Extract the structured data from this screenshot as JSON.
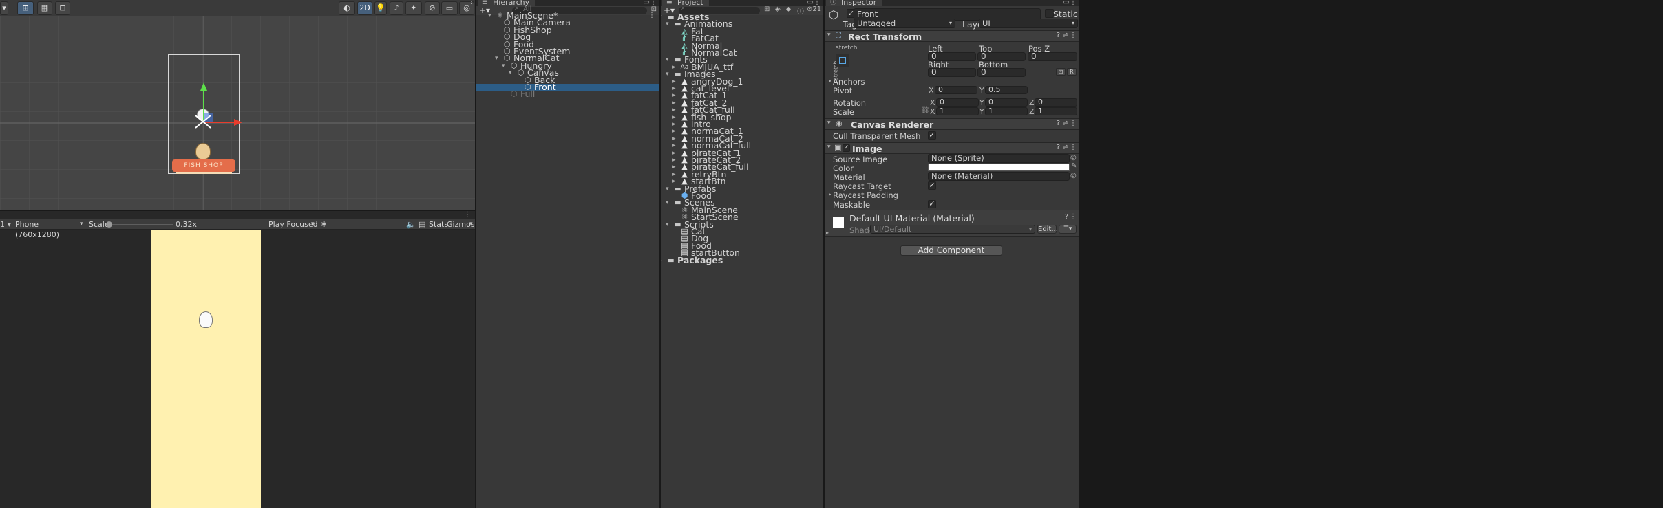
{
  "scene": {
    "toolbar_2d": "2D",
    "canvas_label": "FISH SHOP"
  },
  "game": {
    "display_value": "1",
    "resolution": "Phone (760x1280)",
    "scale_label": "Scale",
    "scale_value": "0.32x",
    "scale_level": 0.02,
    "play_mode": "Play Focused",
    "stats_label": "Stats",
    "gizmos_label": "Gizmos"
  },
  "hierarchy": {
    "tab": "Hierarchy",
    "search_placeholder": "All",
    "items": [
      {
        "label": "MainScene*",
        "depth": 0,
        "type": "scene",
        "expanded": true
      },
      {
        "label": "Main Camera",
        "depth": 1,
        "type": "object"
      },
      {
        "label": "FishShop",
        "depth": 1,
        "type": "object"
      },
      {
        "label": "Dog",
        "depth": 1,
        "type": "object"
      },
      {
        "label": "Food",
        "depth": 1,
        "type": "object"
      },
      {
        "label": "EventSystem",
        "depth": 1,
        "type": "object"
      },
      {
        "label": "NormalCat",
        "depth": 1,
        "type": "object",
        "expanded": true
      },
      {
        "label": "Hungry",
        "depth": 2,
        "type": "object",
        "expanded": true
      },
      {
        "label": "Canvas",
        "depth": 3,
        "type": "object",
        "expanded": true
      },
      {
        "label": "Back",
        "depth": 4,
        "type": "object"
      },
      {
        "label": "Front",
        "depth": 4,
        "type": "object",
        "selected": true
      },
      {
        "label": "Full",
        "depth": 2,
        "type": "object",
        "inactive": true
      }
    ]
  },
  "project": {
    "tab": "Project",
    "hidden_count": "21",
    "items": [
      {
        "label": "Assets",
        "depth": 0,
        "type": "folder",
        "expanded": true,
        "bold": true
      },
      {
        "label": "Animations",
        "depth": 1,
        "type": "folder",
        "expanded": true
      },
      {
        "label": "Fat",
        "depth": 2,
        "type": "anim"
      },
      {
        "label": "FatCat",
        "depth": 2,
        "type": "controller"
      },
      {
        "label": "Normal",
        "depth": 2,
        "type": "anim"
      },
      {
        "label": "NormalCat",
        "depth": 2,
        "type": "controller"
      },
      {
        "label": "Fonts",
        "depth": 1,
        "type": "folder",
        "expanded": true
      },
      {
        "label": "BMJUA_ttf",
        "depth": 2,
        "type": "font",
        "collapsed": true
      },
      {
        "label": "Images",
        "depth": 1,
        "type": "folder",
        "expanded": true
      },
      {
        "label": "angryDog_1",
        "depth": 2,
        "type": "sprite",
        "collapsed": true
      },
      {
        "label": "cat_level",
        "depth": 2,
        "type": "sprite",
        "collapsed": true
      },
      {
        "label": "fatCat_1",
        "depth": 2,
        "type": "sprite",
        "collapsed": true
      },
      {
        "label": "fatCat_2",
        "depth": 2,
        "type": "sprite",
        "collapsed": true
      },
      {
        "label": "fatCat_full",
        "depth": 2,
        "type": "sprite",
        "collapsed": true
      },
      {
        "label": "fish_shop",
        "depth": 2,
        "type": "sprite",
        "collapsed": true
      },
      {
        "label": "intro",
        "depth": 2,
        "type": "sprite",
        "collapsed": true
      },
      {
        "label": "normaCat_1",
        "depth": 2,
        "type": "sprite",
        "collapsed": true
      },
      {
        "label": "normaCat_2",
        "depth": 2,
        "type": "sprite",
        "collapsed": true
      },
      {
        "label": "normaCat_full",
        "depth": 2,
        "type": "sprite",
        "collapsed": true
      },
      {
        "label": "pirateCat_1",
        "depth": 2,
        "type": "sprite",
        "collapsed": true
      },
      {
        "label": "pirateCat_2",
        "depth": 2,
        "type": "sprite",
        "collapsed": true
      },
      {
        "label": "pirateCat_full",
        "depth": 2,
        "type": "sprite",
        "collapsed": true
      },
      {
        "label": "retryBtn",
        "depth": 2,
        "type": "sprite",
        "collapsed": true
      },
      {
        "label": "startBtn",
        "depth": 2,
        "type": "sprite",
        "collapsed": true
      },
      {
        "label": "Prefabs",
        "depth": 1,
        "type": "folder",
        "expanded": true
      },
      {
        "label": "Food",
        "depth": 2,
        "type": "prefab"
      },
      {
        "label": "Scenes",
        "depth": 1,
        "type": "folder",
        "expanded": true
      },
      {
        "label": "MainScene",
        "depth": 2,
        "type": "scene"
      },
      {
        "label": "StartScene",
        "depth": 2,
        "type": "scene"
      },
      {
        "label": "Scripts",
        "depth": 1,
        "type": "folder",
        "expanded": true
      },
      {
        "label": "Cat",
        "depth": 2,
        "type": "script"
      },
      {
        "label": "Dog",
        "depth": 2,
        "type": "script"
      },
      {
        "label": "Food",
        "depth": 2,
        "type": "script"
      },
      {
        "label": "startButton",
        "depth": 2,
        "type": "script"
      },
      {
        "label": "Packages",
        "depth": 0,
        "type": "folder",
        "bold": true,
        "collapsed": true
      }
    ]
  },
  "inspector": {
    "tab": "Inspector",
    "object_name": "Front",
    "static_label": "Static",
    "tag_label": "Tag",
    "tag_value": "Untagged",
    "layer_label": "Layer",
    "layer_value": "UI",
    "rect_transform": {
      "title": "Rect Transform",
      "anchor_preset": "stretch",
      "left_label": "Left",
      "left": "0",
      "top_label": "Top",
      "top": "0",
      "posz_label": "Pos Z",
      "posz": "0",
      "right_label": "Right",
      "right": "0",
      "bottom_label": "Bottom",
      "bottom": "0",
      "anchors_label": "Anchors",
      "pivot_label": "Pivot",
      "pivot_x": "0",
      "pivot_y": "0.5",
      "rotation_label": "Rotation",
      "rot_x": "0",
      "rot_y": "0",
      "rot_z": "0",
      "scale_label": "Scale",
      "scale_x": "1",
      "scale_y": "1",
      "scale_z": "1",
      "raw_edit": "R",
      "x": "X",
      "y": "Y",
      "z": "Z"
    },
    "canvas_renderer": {
      "title": "Canvas Renderer",
      "cull_label": "Cull Transparent Mesh"
    },
    "image": {
      "title": "Image",
      "source_label": "Source Image",
      "source_value": "None (Sprite)",
      "color_label": "Color",
      "color_value": "#ffffff",
      "material_label": "Material",
      "material_value": "None (Material)",
      "raycast_target_label": "Raycast Target",
      "raycast_padding_label": "Raycast Padding",
      "maskable_label": "Maskable"
    },
    "material": {
      "title": "Default UI Material (Material)",
      "shader_label": "Shader",
      "shader_value": "UI/Default",
      "edit_label": "Edit..."
    },
    "add_component": "Add Component"
  },
  "colors": {
    "selection": "#2c5d87",
    "game_bg": "#fff1b0",
    "accent_toggle": "#46607c"
  }
}
